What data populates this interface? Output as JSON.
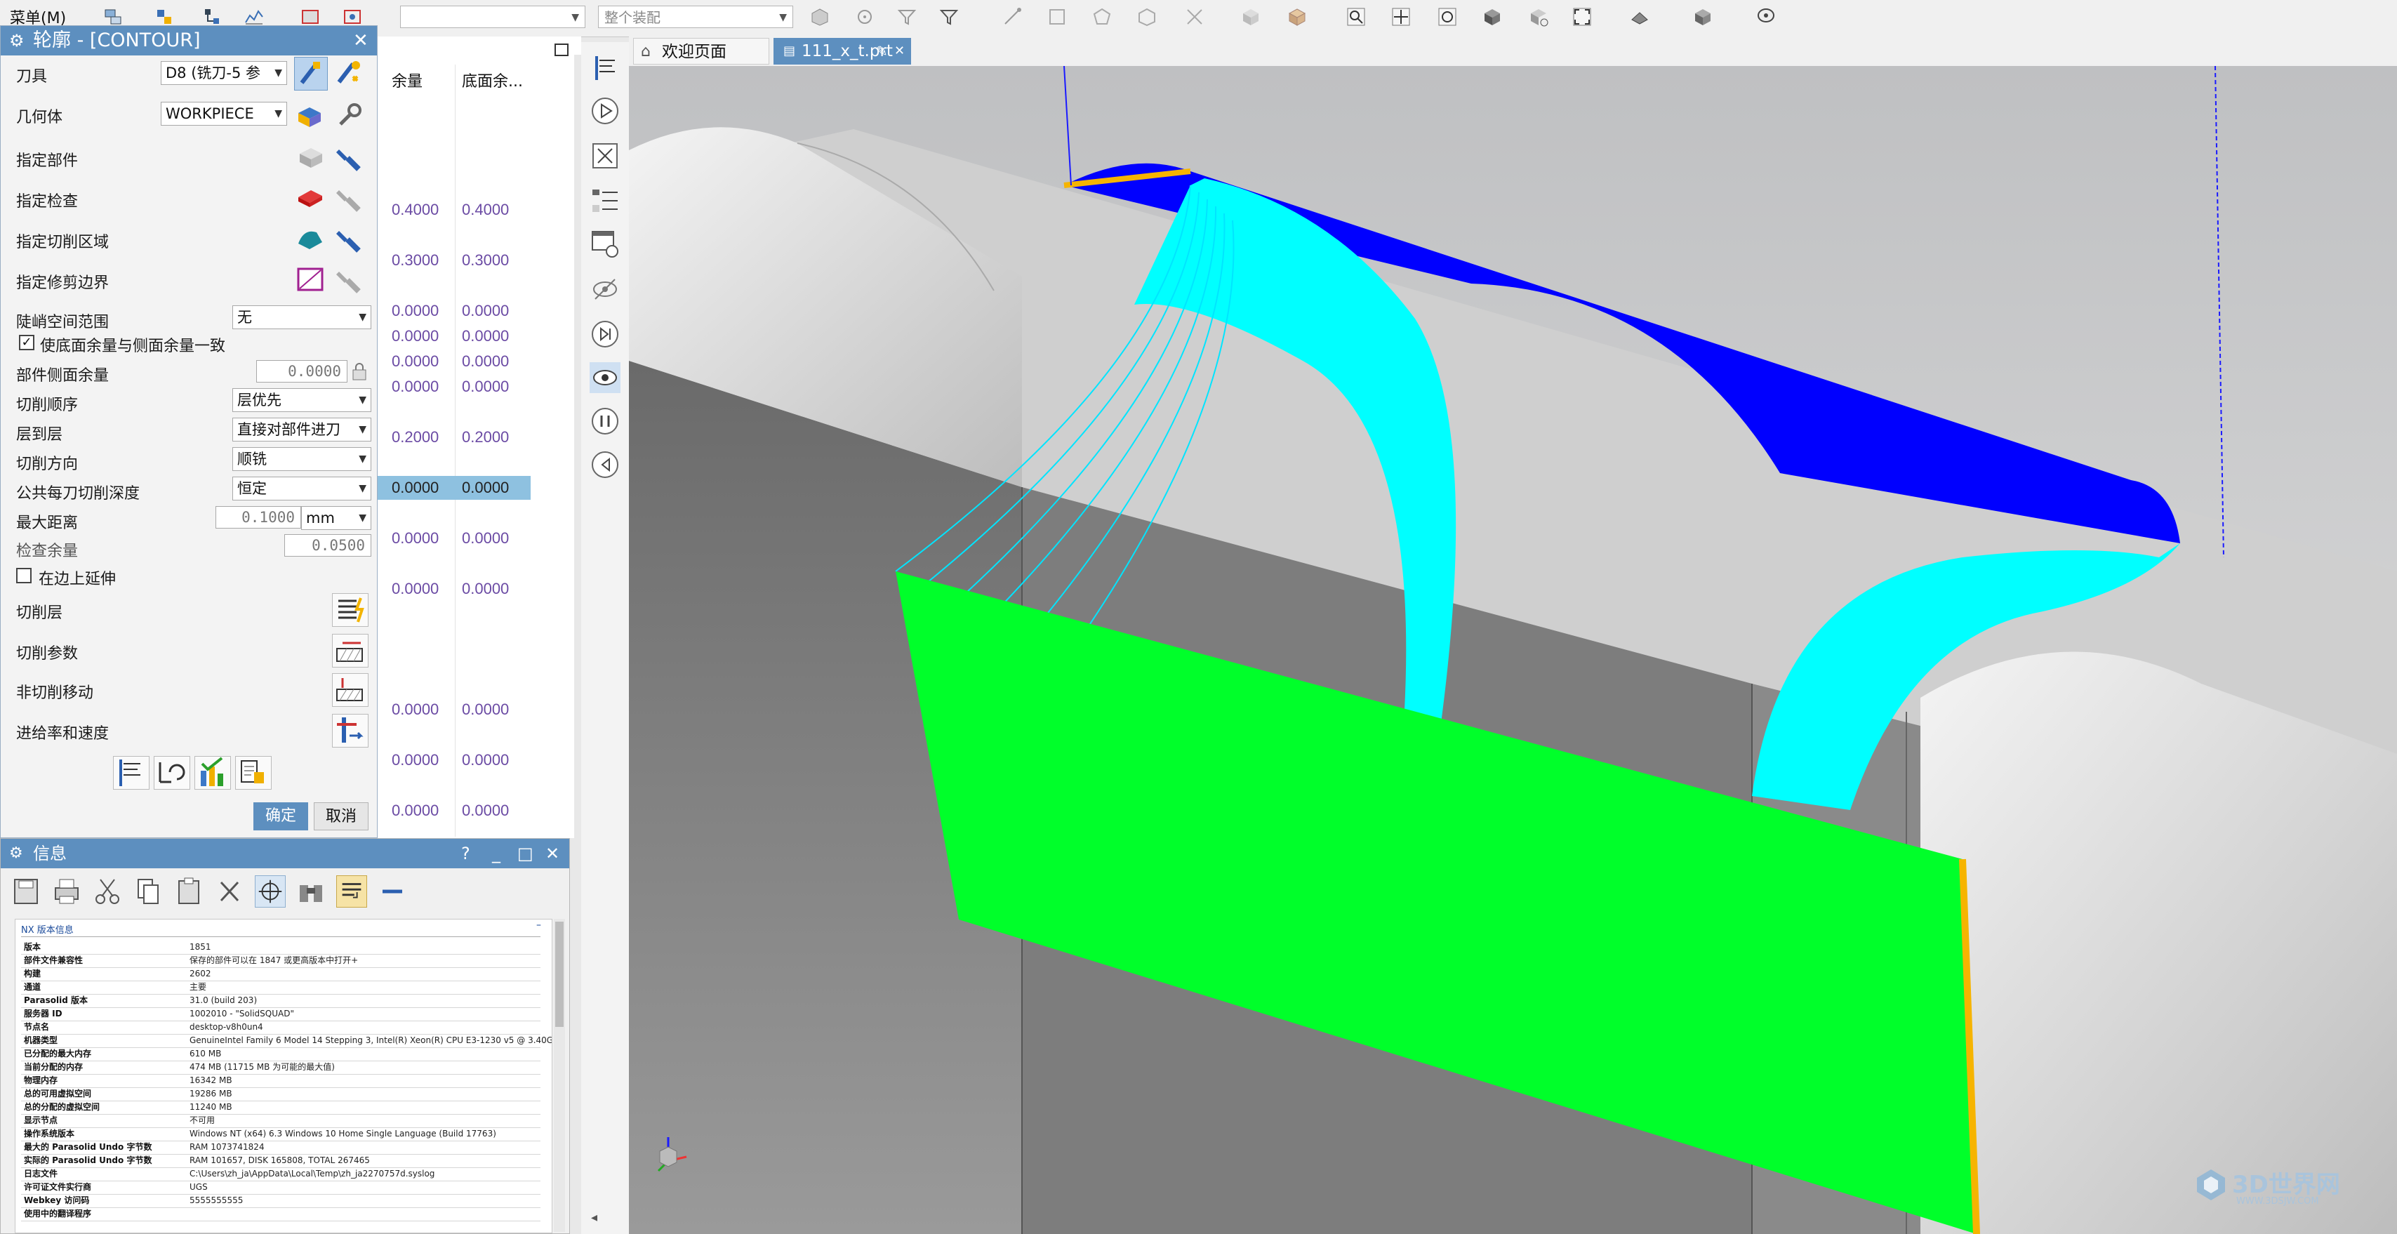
{
  "toolbar": {
    "menu_label": "菜单(M)",
    "filter_placeholder": "",
    "assembly_filter": "整个装配"
  },
  "dialog": {
    "title": "轮廓 - [CONTOUR]",
    "rows": {
      "tool_label": "刀具",
      "tool_value": "D8 (铣刀-5 参",
      "geometry_label": "几何体",
      "geometry_value": "WORKPIECE",
      "part_label": "指定部件",
      "check_label": "指定检查",
      "cut_area_label": "指定切削区域",
      "trim_boundary_label": "指定修剪边界",
      "steep_label": "陡峭空间范围",
      "steep_value": "无",
      "floor_wall_same_label": "使底面余量与侧面余量一致",
      "floor_wall_same_checked": true,
      "wall_stock_label": "部件侧面余量",
      "wall_stock_value": "0.0000",
      "cut_order_label": "切削顺序",
      "cut_order_value": "层优先",
      "level_to_level_label": "层到层",
      "level_to_level_value": "直接对部件进刀",
      "cut_direction_label": "切削方向",
      "cut_direction_value": "顺铣",
      "depth_per_cut_label": "公共每刀切削深度",
      "depth_per_cut_value": "恒定",
      "max_distance_label": "最大距离",
      "max_distance_value": "0.1000",
      "max_distance_unit": "mm",
      "check_stock_label": "检查余量",
      "check_stock_value": "0.0500",
      "extend_at_edges_label": "在边上延伸",
      "extend_at_edges_checked": false,
      "cut_levels_label": "切削层",
      "cut_params_label": "切削参数",
      "non_cutting_label": "非切削移动",
      "feeds_label": "进给率和速度"
    },
    "ok_label": "确定",
    "cancel_label": "取消"
  },
  "columns": {
    "headers": [
      "余量",
      "底面余..."
    ],
    "rows": [
      {
        "a": "0.4000",
        "b": "0.4000"
      },
      {
        "a": "0.3000",
        "b": "0.3000"
      },
      {
        "a": "0.0000",
        "b": "0.0000"
      },
      {
        "a": "0.0000",
        "b": "0.0000"
      },
      {
        "a": "0.0000",
        "b": "0.0000"
      },
      {
        "a": "0.0000",
        "b": "0.0000"
      },
      {
        "a": "0.2000",
        "b": "0.2000"
      },
      {
        "a": "0.0000",
        "b": "0.0000"
      },
      {
        "a": "0.0000",
        "b": "0.0000"
      },
      {
        "a": "0.0000",
        "b": "0.0000"
      },
      {
        "a": "0.0000",
        "b": "0.0000"
      },
      {
        "a": "0.0000",
        "b": "0.0000"
      },
      {
        "a": "0.0000",
        "b": "0.0000"
      }
    ]
  },
  "info": {
    "title": "信息",
    "section": "NX 版本信息",
    "rows": [
      {
        "k": "版本",
        "v": "1851"
      },
      {
        "k": "部件文件兼容性",
        "v": "保存的部件可以在 1847 或更高版本中打开+"
      },
      {
        "k": "构建",
        "v": "2602"
      },
      {
        "k": "通道",
        "v": "主要"
      },
      {
        "k": "Parasolid 版本",
        "v": "31.0 (build 203)"
      },
      {
        "k": "服务器 ID",
        "v": "1002010 - \"SolidSQUAD\""
      },
      {
        "k": "节点名",
        "v": "desktop-v8h0un4"
      },
      {
        "k": "机器类型",
        "v": "GenuineIntel Family 6 Model 14 Stepping 3, Intel(R) Xeon(R) CPU E3-1230 v5 @ 3.40GHz"
      },
      {
        "k": "已分配的最大内存",
        "v": "610 MB"
      },
      {
        "k": "当前分配的内存",
        "v": "474 MB (11715 MB 为可能的最大值)"
      },
      {
        "k": "物理内存",
        "v": "16342 MB"
      },
      {
        "k": "总的可用虚拟空间",
        "v": "19286 MB"
      },
      {
        "k": "总的分配的虚拟空间",
        "v": "11240 MB"
      },
      {
        "k": "显示节点",
        "v": "不可用"
      },
      {
        "k": "操作系统版本",
        "v": "Windows NT (x64) 6.3 Windows 10 Home Single Language (Build 17763)"
      },
      {
        "k": "最大的 Parasolid Undo 字节数",
        "v": "RAM 1073741824"
      },
      {
        "k": "实际的 Parasolid Undo 字节数",
        "v": "RAM 101657, DISK 165808, TOTAL 267465"
      },
      {
        "k": "日志文件",
        "v": "C:\\Users\\zh_ja\\AppData\\Local\\Temp\\zh_ja2270757d.syslog"
      },
      {
        "k": "许可证文件实行商",
        "v": "UGS"
      },
      {
        "k": "Webkey 访问码",
        "v": "5555555555"
      },
      {
        "k": "使用中的翻译程序",
        "v": ""
      }
    ]
  },
  "tabs": [
    {
      "label": "欢迎页面",
      "active": false
    },
    {
      "label": "111_x_t.prt",
      "active": true
    }
  ],
  "watermark": {
    "brand": "3D世界网",
    "url": "WWW.3DSJW.COM"
  },
  "colors": {
    "title_bar": "#5d8fbf",
    "toolpath_blue": "#0000ff",
    "toolpath_cyan": "#00ffff",
    "toolpath_green": "#00ff2a",
    "accent_orange": "#f6b400"
  }
}
